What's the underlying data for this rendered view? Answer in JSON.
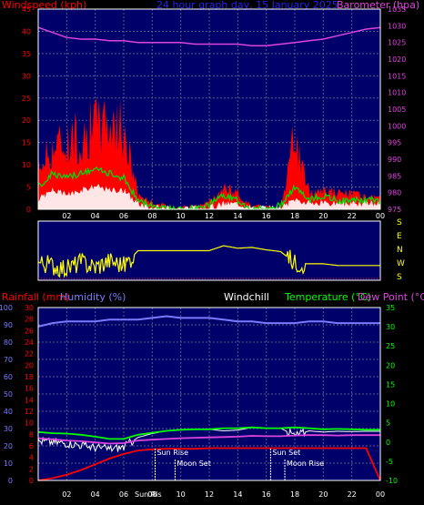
{
  "header": {
    "windspeed_label": "Windspeed (kph)",
    "title": "24 hour graph day, 15 January 2025",
    "barometer_label": "Barometer (hpa)"
  },
  "lower_header": {
    "rainfall_label": "Rainfall (mm)",
    "humidity_label": "Humidity (%)",
    "windchill_label": "Windchill",
    "temperature_label": "Temperature (°C)",
    "dewpoint_label": "Dew Point (°C)"
  },
  "colors": {
    "background": "#000000",
    "plot_bg": "#00006a",
    "grid": "#5a5a8a",
    "wind": "#ff0000",
    "gust_avg": "#00dd00",
    "wind_min": "#ffffff",
    "barometer": "#dd44dd",
    "direction": "#ffff00",
    "direction_line": "#cc9900",
    "humidity": "#7a7aff",
    "temperature": "#00ff00",
    "dewpoint": "#dd44dd",
    "windchill": "#ffffff",
    "rain": "#ff0000",
    "axis_left_top": "#ff0000",
    "axis_right_top": "#dd44dd",
    "axis_left_low": "#ff0000",
    "axis_right_low": "#00ff00"
  },
  "axes": {
    "hour_ticks": [
      "02",
      "04",
      "06",
      "08",
      "10",
      "12",
      "14",
      "16",
      "18",
      "20",
      "22",
      "00"
    ],
    "wind_ticks": [
      "0",
      "5",
      "10",
      "15",
      "20",
      "25",
      "30",
      "35",
      "40",
      "45"
    ],
    "baro_ticks": [
      "975",
      "980",
      "985",
      "990",
      "995",
      "1000",
      "1005",
      "1010",
      "1015",
      "1020",
      "1025",
      "1030",
      "1035"
    ],
    "dir_ticks": [
      "S",
      "E",
      "N",
      "W",
      "S"
    ],
    "humidity_ticks": [
      "0",
      "10",
      "20",
      "30",
      "40",
      "50",
      "60",
      "70",
      "80",
      "90",
      "100"
    ],
    "rain_ticks": [
      "0",
      "2",
      "4",
      "6",
      "8",
      "10",
      "12",
      "14",
      "16",
      "18",
      "20",
      "22",
      "24",
      "26",
      "28",
      "30"
    ],
    "temp_ticks": [
      "-10",
      "-5",
      "0",
      "5",
      "10",
      "15",
      "20",
      "25",
      "30",
      "35"
    ]
  },
  "events": [
    {
      "label": "Sun Rise",
      "hour": 8.2,
      "row": "upper"
    },
    {
      "label": "Moon Set",
      "hour": 9.6,
      "row": "lower"
    },
    {
      "label": "Sun Set",
      "hour": 16.3,
      "row": "upper"
    },
    {
      "label": "Moon Rise",
      "hour": 17.3,
      "row": "lower"
    }
  ],
  "bottom_event_text": "Sun Ris",
  "chart_data": [
    {
      "type": "area",
      "title": "24 hour graph day, 15 January 2025",
      "xlabel": "",
      "ylabel": "Windspeed (kph)",
      "y2label": "Barometer (hpa)",
      "x": [
        0,
        1,
        2,
        3,
        4,
        5,
        6,
        7,
        8,
        9,
        10,
        11,
        12,
        13,
        14,
        15,
        16,
        17,
        18,
        19,
        20,
        21,
        22,
        23,
        24
      ],
      "ylim": [
        0,
        45
      ],
      "y2lim": [
        975,
        1035
      ],
      "series": [
        {
          "name": "Windspeed (kph)",
          "values": [
            8,
            12,
            13,
            14,
            16,
            17,
            15,
            3,
            1,
            0,
            0,
            0,
            1,
            4,
            3,
            0,
            0,
            0,
            14,
            3,
            4,
            3,
            3,
            2,
            2
          ]
        },
        {
          "name": "Gust average",
          "values": [
            5,
            8,
            7,
            8,
            9,
            8,
            7,
            2,
            1,
            0,
            0,
            0,
            1,
            3,
            2,
            0,
            0,
            1,
            5,
            2,
            3,
            2,
            2,
            2,
            2
          ]
        },
        {
          "name": "Wind minimum",
          "values": [
            2,
            4,
            3,
            4,
            5,
            4,
            4,
            1,
            0,
            0,
            0,
            0,
            0,
            1,
            1,
            0,
            0,
            0,
            2,
            1,
            1,
            1,
            1,
            1,
            1
          ]
        },
        {
          "name": "Barometer (hpa)",
          "values": [
            1029.5,
            1028,
            1026.5,
            1026,
            1026,
            1025.5,
            1025.5,
            1025,
            1025,
            1025,
            1025,
            1024.5,
            1024.5,
            1024.5,
            1024.5,
            1024,
            1024,
            1024.5,
            1025,
            1025.5,
            1026,
            1027,
            1028,
            1029,
            1029.5
          ]
        }
      ]
    },
    {
      "type": "line",
      "title": "",
      "xlabel": "",
      "ylabel": "",
      "x": [
        0,
        1,
        2,
        3,
        4,
        5,
        6,
        7,
        8,
        9,
        10,
        11,
        12,
        13,
        14,
        15,
        16,
        17,
        18,
        19,
        20,
        21,
        22,
        23,
        24
      ],
      "yticks": [
        "S",
        "E",
        "N",
        "W",
        "S"
      ],
      "series": [
        {
          "name": "",
          "values": [
            110,
            90,
            70,
            110,
            80,
            120,
            90,
            180,
            180,
            180,
            180,
            180,
            180,
            210,
            195,
            200,
            185,
            175,
            105,
            100,
            100,
            90,
            90,
            90,
            90
          ]
        }
      ]
    },
    {
      "type": "line",
      "title": "",
      "xlabel": "",
      "ylabel": "Rainfall (mm)",
      "y2label": "Temperature (°C)",
      "x": [
        0,
        1,
        2,
        3,
        4,
        5,
        6,
        7,
        8,
        9,
        10,
        11,
        12,
        13,
        14,
        15,
        16,
        17,
        18,
        19,
        20,
        21,
        22,
        23,
        24
      ],
      "ylim": [
        0,
        30
      ],
      "y2lim": [
        -10,
        35
      ],
      "y3lim": [
        0,
        100
      ],
      "series": [
        {
          "name": "Rainfall (mm)",
          "values": [
            0,
            0.4,
            1,
            1.8,
            2.8,
            3.8,
            4.6,
            5.2,
            5.4,
            5.5,
            5.5,
            5.5,
            5.6,
            5.6,
            5.6,
            5.6,
            5.6,
            5.6,
            5.6,
            5.6,
            5.6,
            5.6,
            5.6,
            5.6,
            0
          ]
        },
        {
          "name": "Humidity (%)",
          "values": [
            89,
            91,
            92,
            92,
            92,
            93,
            93,
            93,
            94,
            95,
            94,
            94,
            94,
            93,
            92,
            92,
            91,
            91,
            91,
            92,
            92,
            91,
            91,
            91,
            91
          ]
        },
        {
          "name": "Temperature (°C)",
          "values": [
            2.6,
            2.3,
            2.2,
            1.9,
            1.4,
            0.8,
            0.8,
            1.9,
            2.4,
            2.9,
            3.2,
            3.3,
            3.3,
            3.6,
            3.6,
            3.8,
            3.6,
            3.6,
            3.8,
            3.6,
            3.3,
            3.4,
            3.3,
            3.2,
            3.2
          ]
        },
        {
          "name": "Dew Point (°C)",
          "values": [
            1,
            0.7,
            0.4,
            0.2,
            -0.1,
            -0.4,
            -0.3,
            0.4,
            0.6,
            0.8,
            1,
            1.1,
            1.2,
            1.3,
            1.4,
            1.6,
            1.5,
            1.5,
            1.7,
            1.8,
            1.8,
            1.7,
            1.8,
            1.8,
            1.8
          ]
        },
        {
          "name": "Windchill",
          "values": [
            0.3,
            0,
            -0.3,
            -0.8,
            -1.4,
            -1.8,
            -1.3,
            1.2,
            2.2,
            2.9,
            3.2,
            3.3,
            3.3,
            2.9,
            3.1,
            3.8,
            3.6,
            3.6,
            1.7,
            2.9,
            2.6,
            2.8,
            2.7,
            2.8,
            2.8
          ]
        }
      ]
    }
  ]
}
